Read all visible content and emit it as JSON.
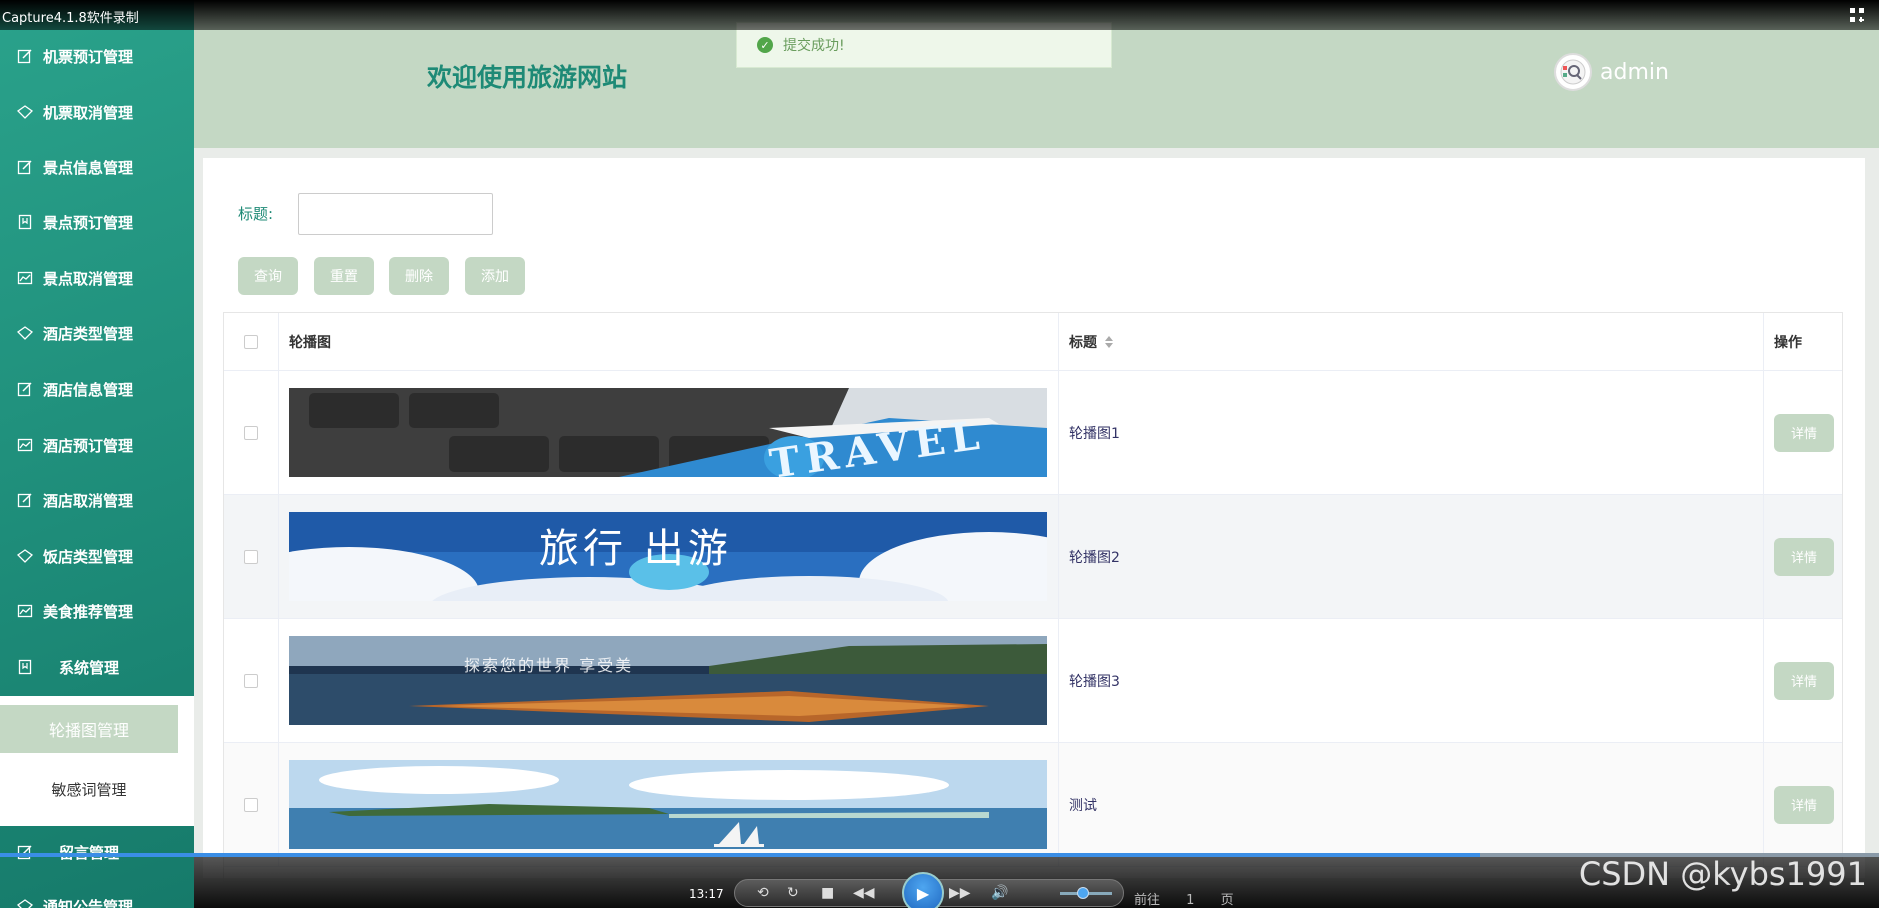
{
  "recorder": {
    "title": "Capture4.1.8软件录制"
  },
  "sidebar": {
    "items": [
      {
        "label": "机票预订管理",
        "icon": "edit-icon"
      },
      {
        "label": "机票取消管理",
        "icon": "diamond-icon"
      },
      {
        "label": "景点信息管理",
        "icon": "edit-icon"
      },
      {
        "label": "景点预订管理",
        "icon": "bookmark-icon"
      },
      {
        "label": "景点取消管理",
        "icon": "chart-icon"
      },
      {
        "label": "酒店类型管理",
        "icon": "diamond-icon"
      },
      {
        "label": "酒店信息管理",
        "icon": "edit-icon"
      },
      {
        "label": "酒店预订管理",
        "icon": "chart-icon"
      },
      {
        "label": "酒店取消管理",
        "icon": "edit-icon"
      },
      {
        "label": "饭店类型管理",
        "icon": "diamond-icon"
      },
      {
        "label": "美食推荐管理",
        "icon": "chart-icon"
      },
      {
        "label": "系统管理",
        "icon": "bookmark-icon"
      },
      {
        "label": "留言管理",
        "icon": "edit-icon"
      },
      {
        "label": "通知公告管理",
        "icon": "diamond-icon"
      }
    ],
    "submenu": {
      "active": "轮播图管理",
      "other": "敏感词管理"
    }
  },
  "header": {
    "site_title": "欢迎使用旅游网站",
    "username": "admin"
  },
  "toast": {
    "message": "提交成功!"
  },
  "search": {
    "label": "标题:",
    "value": ""
  },
  "toolbar": {
    "query": "查询",
    "reset": "重置",
    "delete": "删除",
    "add": "添加"
  },
  "table": {
    "headers": {
      "image": "轮播图",
      "title": "标题",
      "action": "操作"
    },
    "rows": [
      {
        "title": "轮播图1",
        "action": "详情",
        "banner_text": "TRAVEL"
      },
      {
        "title": "轮播图2",
        "action": "详情",
        "banner_text": "旅行  出游"
      },
      {
        "title": "轮播图3",
        "action": "详情",
        "banner_text": "探索您的世界 享受美"
      },
      {
        "title": "测试",
        "action": "详情",
        "banner_text": ""
      }
    ]
  },
  "player": {
    "time": "13:17",
    "page_prefix": "前往",
    "page_number": "1",
    "page_suffix": "页"
  },
  "watermark": "CSDN @kybs1991"
}
